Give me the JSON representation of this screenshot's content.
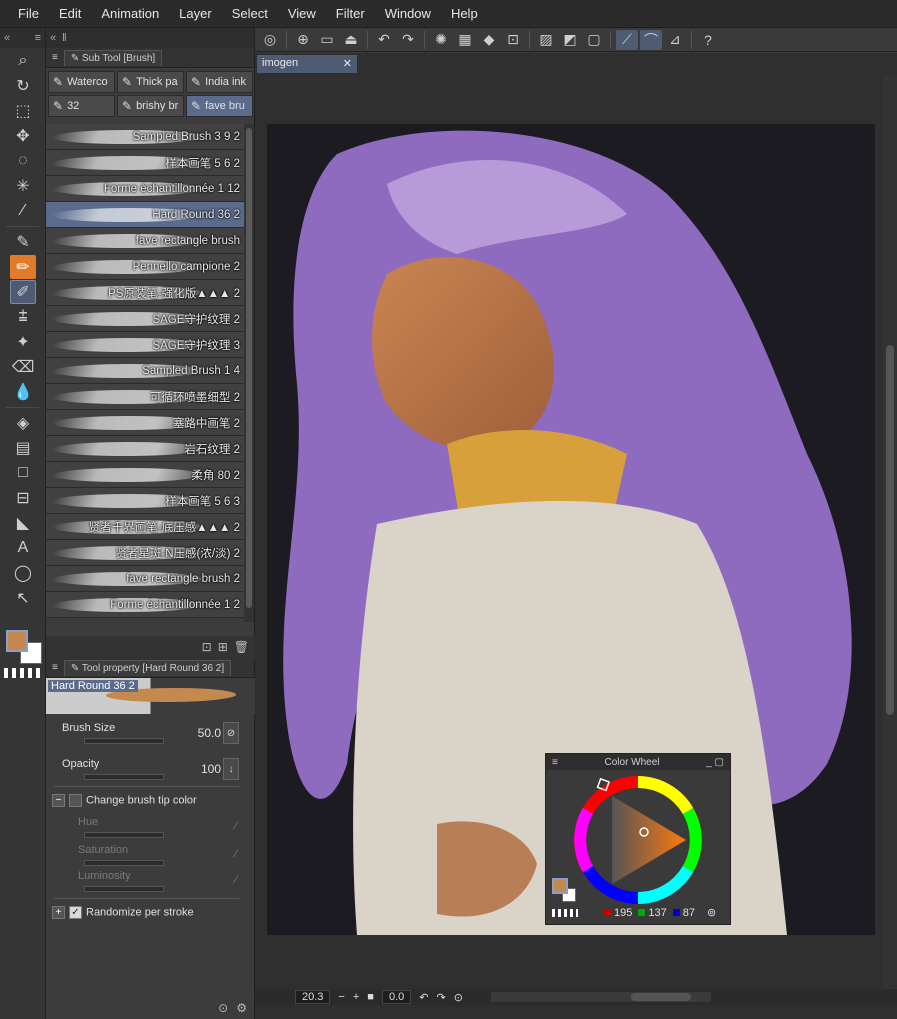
{
  "menu": [
    "File",
    "Edit",
    "Animation",
    "Layer",
    "Select",
    "View",
    "Filter",
    "Window",
    "Help"
  ],
  "subtool_panel": {
    "title": "Sub Tool [Brush]",
    "grid": [
      "Waterco",
      "Thick pa",
      "India ink",
      "32",
      "brishy br",
      "fave bru"
    ],
    "active_grid_index": 5,
    "brushes": [
      "Sampled Brush 3 9 2",
      "样本画笔 5 6 2",
      "Forme échantillonnée 1 12",
      "Hard Round 36 2",
      "fave rectangle brush",
      "Pennello campione 2",
      "PS原装笔-强化版▲▲▲ 2",
      "SAGE守护纹理 2",
      "SAGE守护纹理 3",
      "Sampled Brush 1 4",
      "可循环喷墨细型 2",
      "塞路中画笔 2",
      "岩石纹理 2",
      "柔角 80 2",
      "样本画笔 5 6 3",
      "贤者千界画笔-底压感▲▲▲ 2",
      "贤者星斑-N压感(浓/淡) 2",
      "fave rectangle brush 2",
      "Forme échantillonnée 1 2"
    ],
    "active_brush_index": 3
  },
  "tool_property": {
    "title": "Tool property [Hard Round 36 2]",
    "preview_name": "Hard Round 36 2",
    "brush_size_label": "Brush Size",
    "brush_size_value": "50.0",
    "opacity_label": "Opacity",
    "opacity_value": "100",
    "change_tip_label": "Change brush tip color",
    "hue_label": "Hue",
    "saturation_label": "Saturation",
    "luminosity_label": "Luminosity",
    "randomize_label": "Randomize per stroke"
  },
  "document": {
    "tab_name": "imogen",
    "zoom": "20.3",
    "rotation": "0.0"
  },
  "color_wheel": {
    "title": "Color Wheel",
    "r": "195",
    "g": "137",
    "b": "87",
    "main_color": "#c3894f",
    "sub_color": "#ffffff"
  },
  "colors": {
    "accent": "#4f5b73",
    "tool_highlight": "#e07b2a"
  }
}
